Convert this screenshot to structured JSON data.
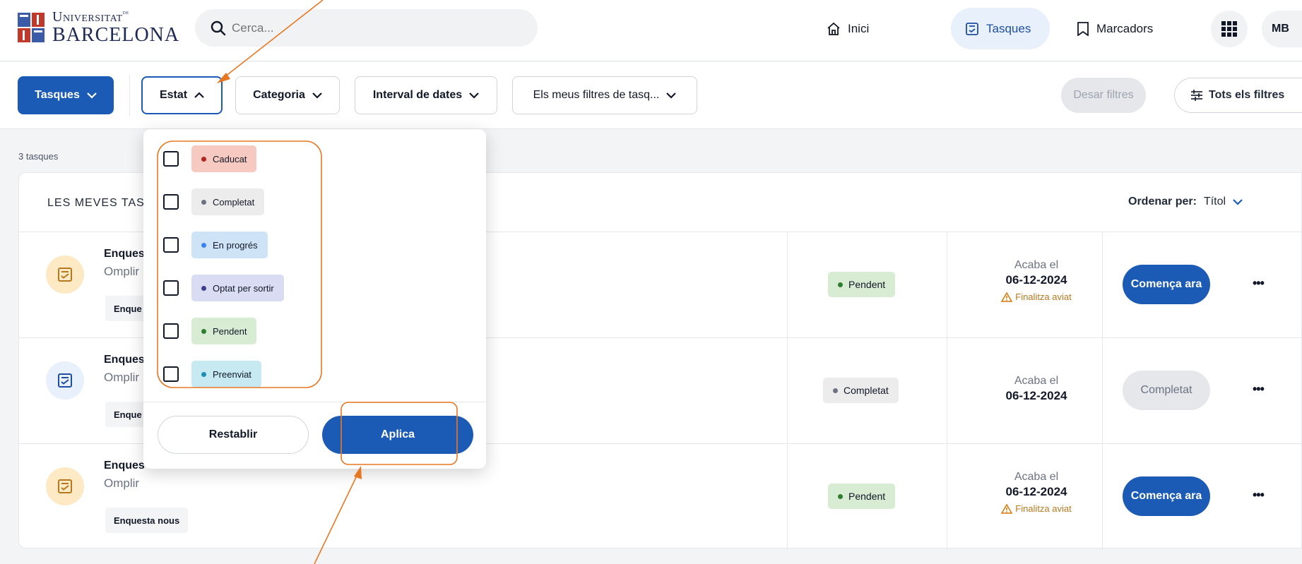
{
  "brand": {
    "line1": "Universitat",
    "line1_sup": "de",
    "line2": "BARCELONA"
  },
  "search": {
    "placeholder": "Cerca..."
  },
  "nav": {
    "home": "Inici",
    "tasks": "Tasques",
    "bookmarks": "Marcadors",
    "user_initials": "MB"
  },
  "filters": {
    "tasks_button": "Tasques",
    "estat": "Estat",
    "categoria": "Categoria",
    "dates": "Interval de dates",
    "my_filters": "Els meus filtres de tasq...",
    "save": "Desar filtres",
    "all": "Tots els filtres"
  },
  "task_count": "3 tasques",
  "list": {
    "title": "LES MEVES TASC",
    "sort_label": "Ordenar per:",
    "sort_value": "Títol",
    "rows": [
      {
        "name": "Enques",
        "desc": "Omplir",
        "tag": "Enque",
        "status": "Pendent",
        "due_label": "Acaba el",
        "due_date": "06-12-2024",
        "warning": "Finalitza aviat",
        "action": "Comença ara"
      },
      {
        "name": "Enques",
        "desc": "Omplir",
        "tag": "Enque",
        "status": "Completat",
        "due_label": "Acaba el",
        "due_date": "06-12-2024",
        "action": "Completat"
      },
      {
        "name": "Enques",
        "desc": "Omplir",
        "tag": "Enquesta nous",
        "status": "Pendent",
        "due_label": "Acaba el",
        "due_date": "06-12-2024",
        "warning": "Finalitza aviat",
        "action": "Comença ara"
      }
    ]
  },
  "dropdown": {
    "options": [
      {
        "label": "Caducat",
        "bg": "#f6c9c1",
        "dot": "#b3261e"
      },
      {
        "label": "Completat",
        "bg": "#ececec",
        "dot": "#6b7280"
      },
      {
        "label": "En progrés",
        "bg": "#cfe3f7",
        "dot": "#3b82f6"
      },
      {
        "label": "Optat per sortir",
        "bg": "#d9dcf3",
        "dot": "#3f3f8f"
      },
      {
        "label": "Pendent",
        "bg": "#d8ebd3",
        "dot": "#2f7d32"
      },
      {
        "label": "Preenviat",
        "bg": "#c7e9f1",
        "dot": "#1d8fb5"
      }
    ],
    "reset": "Restablir",
    "apply": "Aplica"
  },
  "colors": {
    "primary": "#1c5bb5",
    "annotation": "#e87722",
    "warning": "#b7791f"
  }
}
